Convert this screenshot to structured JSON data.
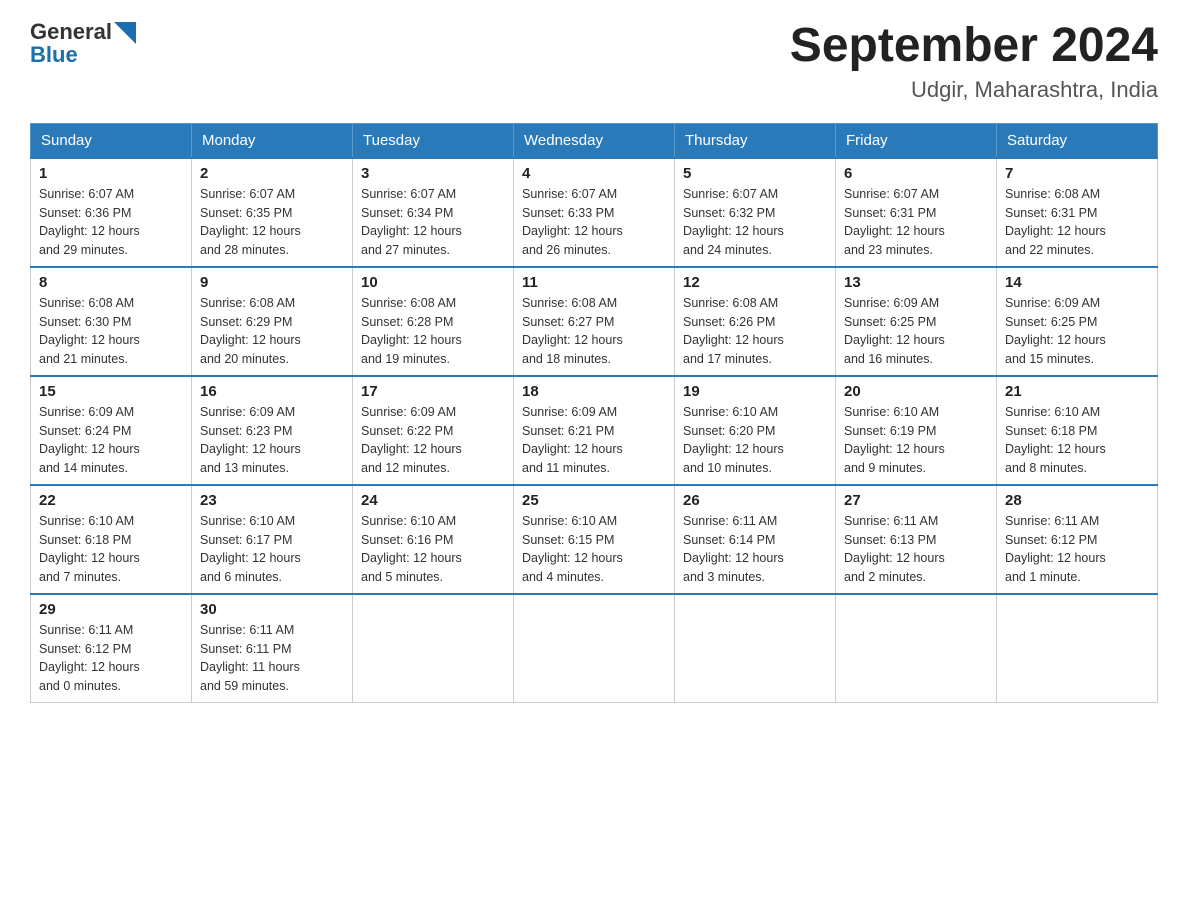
{
  "header": {
    "logo": {
      "general": "General",
      "blue": "Blue"
    },
    "title": "September 2024",
    "location": "Udgir, Maharashtra, India"
  },
  "days_of_week": [
    "Sunday",
    "Monday",
    "Tuesday",
    "Wednesday",
    "Thursday",
    "Friday",
    "Saturday"
  ],
  "weeks": [
    [
      {
        "date": "1",
        "sunrise": "6:07 AM",
        "sunset": "6:36 PM",
        "daylight": "12 hours and 29 minutes."
      },
      {
        "date": "2",
        "sunrise": "6:07 AM",
        "sunset": "6:35 PM",
        "daylight": "12 hours and 28 minutes."
      },
      {
        "date": "3",
        "sunrise": "6:07 AM",
        "sunset": "6:34 PM",
        "daylight": "12 hours and 27 minutes."
      },
      {
        "date": "4",
        "sunrise": "6:07 AM",
        "sunset": "6:33 PM",
        "daylight": "12 hours and 26 minutes."
      },
      {
        "date": "5",
        "sunrise": "6:07 AM",
        "sunset": "6:32 PM",
        "daylight": "12 hours and 24 minutes."
      },
      {
        "date": "6",
        "sunrise": "6:07 AM",
        "sunset": "6:31 PM",
        "daylight": "12 hours and 23 minutes."
      },
      {
        "date": "7",
        "sunrise": "6:08 AM",
        "sunset": "6:31 PM",
        "daylight": "12 hours and 22 minutes."
      }
    ],
    [
      {
        "date": "8",
        "sunrise": "6:08 AM",
        "sunset": "6:30 PM",
        "daylight": "12 hours and 21 minutes."
      },
      {
        "date": "9",
        "sunrise": "6:08 AM",
        "sunset": "6:29 PM",
        "daylight": "12 hours and 20 minutes."
      },
      {
        "date": "10",
        "sunrise": "6:08 AM",
        "sunset": "6:28 PM",
        "daylight": "12 hours and 19 minutes."
      },
      {
        "date": "11",
        "sunrise": "6:08 AM",
        "sunset": "6:27 PM",
        "daylight": "12 hours and 18 minutes."
      },
      {
        "date": "12",
        "sunrise": "6:08 AM",
        "sunset": "6:26 PM",
        "daylight": "12 hours and 17 minutes."
      },
      {
        "date": "13",
        "sunrise": "6:09 AM",
        "sunset": "6:25 PM",
        "daylight": "12 hours and 16 minutes."
      },
      {
        "date": "14",
        "sunrise": "6:09 AM",
        "sunset": "6:25 PM",
        "daylight": "12 hours and 15 minutes."
      }
    ],
    [
      {
        "date": "15",
        "sunrise": "6:09 AM",
        "sunset": "6:24 PM",
        "daylight": "12 hours and 14 minutes."
      },
      {
        "date": "16",
        "sunrise": "6:09 AM",
        "sunset": "6:23 PM",
        "daylight": "12 hours and 13 minutes."
      },
      {
        "date": "17",
        "sunrise": "6:09 AM",
        "sunset": "6:22 PM",
        "daylight": "12 hours and 12 minutes."
      },
      {
        "date": "18",
        "sunrise": "6:09 AM",
        "sunset": "6:21 PM",
        "daylight": "12 hours and 11 minutes."
      },
      {
        "date": "19",
        "sunrise": "6:10 AM",
        "sunset": "6:20 PM",
        "daylight": "12 hours and 10 minutes."
      },
      {
        "date": "20",
        "sunrise": "6:10 AM",
        "sunset": "6:19 PM",
        "daylight": "12 hours and 9 minutes."
      },
      {
        "date": "21",
        "sunrise": "6:10 AM",
        "sunset": "6:18 PM",
        "daylight": "12 hours and 8 minutes."
      }
    ],
    [
      {
        "date": "22",
        "sunrise": "6:10 AM",
        "sunset": "6:18 PM",
        "daylight": "12 hours and 7 minutes."
      },
      {
        "date": "23",
        "sunrise": "6:10 AM",
        "sunset": "6:17 PM",
        "daylight": "12 hours and 6 minutes."
      },
      {
        "date": "24",
        "sunrise": "6:10 AM",
        "sunset": "6:16 PM",
        "daylight": "12 hours and 5 minutes."
      },
      {
        "date": "25",
        "sunrise": "6:10 AM",
        "sunset": "6:15 PM",
        "daylight": "12 hours and 4 minutes."
      },
      {
        "date": "26",
        "sunrise": "6:11 AM",
        "sunset": "6:14 PM",
        "daylight": "12 hours and 3 minutes."
      },
      {
        "date": "27",
        "sunrise": "6:11 AM",
        "sunset": "6:13 PM",
        "daylight": "12 hours and 2 minutes."
      },
      {
        "date": "28",
        "sunrise": "6:11 AM",
        "sunset": "6:12 PM",
        "daylight": "12 hours and 1 minute."
      }
    ],
    [
      {
        "date": "29",
        "sunrise": "6:11 AM",
        "sunset": "6:12 PM",
        "daylight": "12 hours and 0 minutes."
      },
      {
        "date": "30",
        "sunrise": "6:11 AM",
        "sunset": "6:11 PM",
        "daylight": "11 hours and 59 minutes."
      },
      null,
      null,
      null,
      null,
      null
    ]
  ],
  "labels": {
    "sunrise": "Sunrise:",
    "sunset": "Sunset:",
    "daylight": "Daylight:"
  }
}
